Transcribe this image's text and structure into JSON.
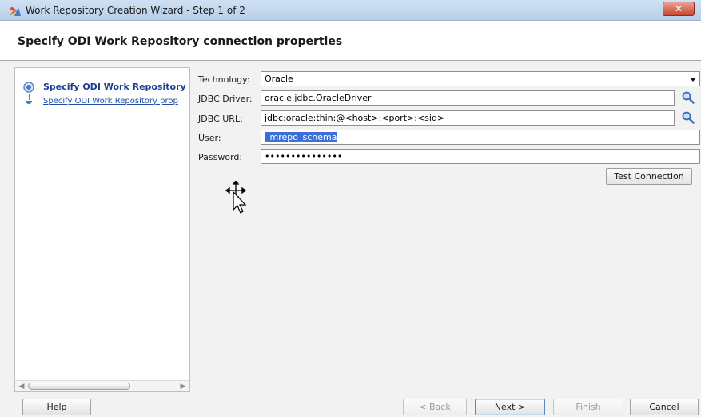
{
  "window": {
    "title": "Work Repository Creation Wizard - Step 1 of 2",
    "close_label": "✕"
  },
  "header": {
    "title": "Specify ODI Work Repository connection properties"
  },
  "steps": [
    {
      "label": "Specify ODI Work Repository",
      "state": "current"
    },
    {
      "label": "Specify ODI Work Repository prop",
      "state": "link"
    }
  ],
  "form": {
    "technology": {
      "label": "Technology:",
      "value": "Oracle"
    },
    "jdbc_driver": {
      "label": "JDBC Driver:",
      "value": "oracle.jdbc.OracleDriver"
    },
    "jdbc_url": {
      "label": "JDBC URL:",
      "value": "jdbc:oracle:thin:@<host>:<port>:<sid>"
    },
    "user": {
      "label": "User:",
      "value": "_mrepo_schema"
    },
    "password": {
      "label": "Password:",
      "value": "•••••••••••••••"
    },
    "test_connection_label": "Test Connection"
  },
  "footer": {
    "help_label": "Help",
    "back_label": "< Back",
    "next_label": "Next >",
    "finish_label": "Finish",
    "cancel_label": "Cancel"
  }
}
